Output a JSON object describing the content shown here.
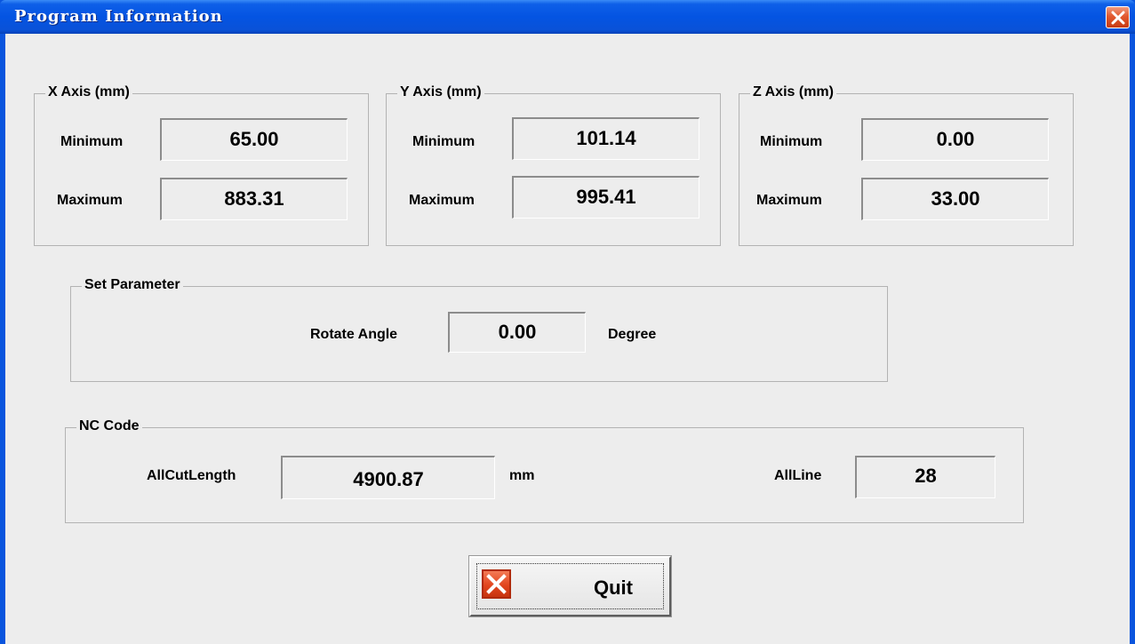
{
  "window": {
    "title": "Program Information"
  },
  "axes": [
    {
      "title": "X Axis (mm)",
      "min_label": "Minimum",
      "min": "65.00",
      "max_label": "Maximum",
      "max": "883.31"
    },
    {
      "title": "Y Axis (mm)",
      "min_label": "Minimum",
      "min": "101.14",
      "max_label": "Maximum",
      "max": "995.41"
    },
    {
      "title": "Z Axis (mm)",
      "min_label": "Minimum",
      "min": "0.00",
      "max_label": "Maximum",
      "max": "33.00"
    }
  ],
  "set_parameter": {
    "title": "Set Parameter",
    "rotate_label": "Rotate Angle",
    "rotate_value": "0.00",
    "rotate_unit": "Degree"
  },
  "nc_code": {
    "title": "NC Code",
    "cut_length_label": "AllCutLength",
    "cut_length_value": "4900.87",
    "cut_length_unit": "mm",
    "all_line_label": "AllLine",
    "all_line_value": "28"
  },
  "buttons": {
    "quit_label": "Quit"
  },
  "icons": {
    "close": "close-icon",
    "quit": "quit-x-icon"
  },
  "colors": {
    "titlebar": "#0454E2",
    "dialog_bg": "#EDEDED",
    "close_red": "#E2592F"
  }
}
